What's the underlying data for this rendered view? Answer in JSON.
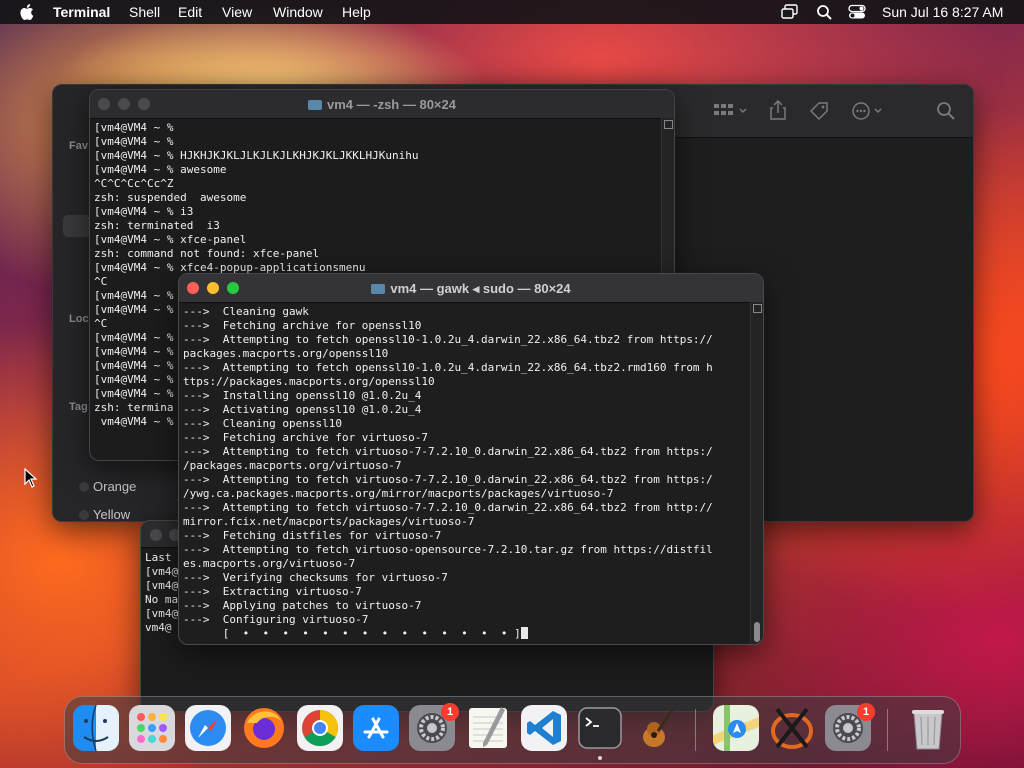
{
  "menubar": {
    "app": "Terminal",
    "items": [
      "Shell",
      "Edit",
      "View",
      "Window",
      "Help"
    ],
    "clock": "Sun Jul 16  8:27 AM"
  },
  "finder": {
    "sidebar_labels": [
      "Fav",
      "Loc",
      "Tag"
    ],
    "tags": [
      "Orange",
      "Yellow"
    ]
  },
  "term1": {
    "title": "vm4 — -zsh — 80×24",
    "lines": [
      "[vm4@VM4 ~ %",
      "[vm4@VM4 ~ %",
      "[vm4@VM4 ~ % HJKHJKJKLJLKJLKJLKHJKJKLJKKLHJKunihu",
      "[vm4@VM4 ~ % awesome",
      "^C^C^Cc^Cc^Z",
      "zsh: suspended  awesome",
      "[vm4@VM4 ~ % i3",
      "zsh: terminated  i3",
      "[vm4@VM4 ~ % xfce-panel",
      "zsh: command not found: xfce-panel",
      "[vm4@VM4 ~ % xfce4-popup-applicationsmenu",
      "^C",
      "[vm4@VM4 ~ %",
      "[vm4@VM4 ~ %",
      "^C",
      "[vm4@VM4 ~ %",
      "[vm4@VM4 ~ %",
      "[vm4@VM4 ~ %",
      "[vm4@VM4 ~ %",
      "[vm4@VM4 ~ %",
      "zsh: termina",
      " vm4@VM4 ~ %"
    ]
  },
  "term2": {
    "title": "vm4 — gawk ◂ sudo — 80×24",
    "lines": [
      "--->  Cleaning gawk",
      "--->  Fetching archive for openssl10",
      "--->  Attempting to fetch openssl10-1.0.2u_4.darwin_22.x86_64.tbz2 from https://",
      "packages.macports.org/openssl10",
      "--->  Attempting to fetch openssl10-1.0.2u_4.darwin_22.x86_64.tbz2.rmd160 from h",
      "ttps://packages.macports.org/openssl10",
      "--->  Installing openssl10 @1.0.2u_4",
      "--->  Activating openssl10 @1.0.2u_4",
      "--->  Cleaning openssl10",
      "--->  Fetching archive for virtuoso-7",
      "--->  Attempting to fetch virtuoso-7-7.2.10_0.darwin_22.x86_64.tbz2 from https:/",
      "/packages.macports.org/virtuoso-7",
      "--->  Attempting to fetch virtuoso-7-7.2.10_0.darwin_22.x86_64.tbz2 from https:/",
      "/ywg.ca.packages.macports.org/mirror/macports/packages/virtuoso-7",
      "--->  Attempting to fetch virtuoso-7-7.2.10_0.darwin_22.x86_64.tbz2 from http://",
      "mirror.fcix.net/macports/packages/virtuoso-7",
      "--->  Fetching distfiles for virtuoso-7",
      "--->  Attempting to fetch virtuoso-opensource-7.2.10.tar.gz from https://distfil",
      "es.macports.org/virtuoso-7",
      "--->  Verifying checksums for virtuoso-7",
      "--->  Extracting virtuoso-7",
      "--->  Applying patches to virtuoso-7",
      "--->  Configuring virtuoso-7",
      "      [  •  •  •  •  •  •  •  •  •  •  •  •  •  • ]"
    ]
  },
  "term3": {
    "lines": [
      "Last",
      "[vm4@",
      "[vm4@",
      "No ma",
      "[vm4@",
      "vm4@"
    ]
  },
  "dock": {
    "apps": [
      "Finder",
      "Launchpad",
      "Safari",
      "Firefox",
      "Chrome",
      "App Store",
      "System Settings",
      "TextEdit",
      "VS Code",
      "Terminal",
      "GarageBand",
      "Maps",
      "X11",
      "System Settings",
      "Trash"
    ],
    "badges": [
      "1",
      "1"
    ]
  }
}
